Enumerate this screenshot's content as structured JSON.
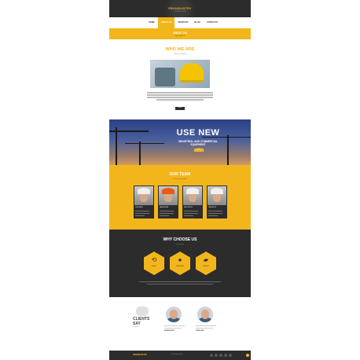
{
  "header": {
    "logo": "PROINDUSTRY",
    "tagline": "CONSTRUCTION"
  },
  "nav": {
    "items": [
      "HOME",
      "ABOUT US",
      "SERVICES",
      "BLOG",
      "CONTACTS"
    ],
    "active": 1
  },
  "page_title": {
    "title": "ABOUT US",
    "breadcrumb": "Home / About Us"
  },
  "who": {
    "title": "WHO WE ARE",
    "subtitle": "about our company",
    "button": "MORE"
  },
  "banner": {
    "title": "USE NEW",
    "subtitle_line1": "INDUSTRIAL AND COMMERCIAL",
    "subtitle_line2": "EQUIPMENT",
    "button": "MORE"
  },
  "team": {
    "title": "OUR TEAM",
    "subtitle": "the best professionals",
    "members": [
      {
        "name": "JOHN SMITH",
        "hat": "#f0f0f0"
      },
      {
        "name": "MARK BROWN",
        "hat": "#e85a1e"
      },
      {
        "name": "PAUL WILSON",
        "hat": "#f0f0f0"
      },
      {
        "name": "LISA TAYLOR",
        "hat": "#f0f0f0"
      }
    ]
  },
  "why": {
    "title": "WHY CHOOSE US",
    "subtitle": "our services",
    "items": [
      {
        "icon": "clock-icon",
        "glyph": "⟲",
        "label": "QUALITY"
      },
      {
        "icon": "globe-icon",
        "glyph": "●",
        "label": "WORLDWIDE"
      },
      {
        "icon": "truck-icon",
        "glyph": "▰",
        "label": "DELIVERY"
      }
    ]
  },
  "clients": {
    "title_line1": "CLIENTS",
    "title_line2": "SAY",
    "subtitle": "testimonials",
    "people": [
      {
        "name": "ANDREW MILLER"
      },
      {
        "name": "PETER JONES"
      }
    ]
  },
  "footer": {
    "logo": "PROINDUSTRY",
    "copyright": "© 2015 | Privacy Policy"
  },
  "colors": {
    "accent": "#f2b61c",
    "dark": "#2c2c2c"
  }
}
